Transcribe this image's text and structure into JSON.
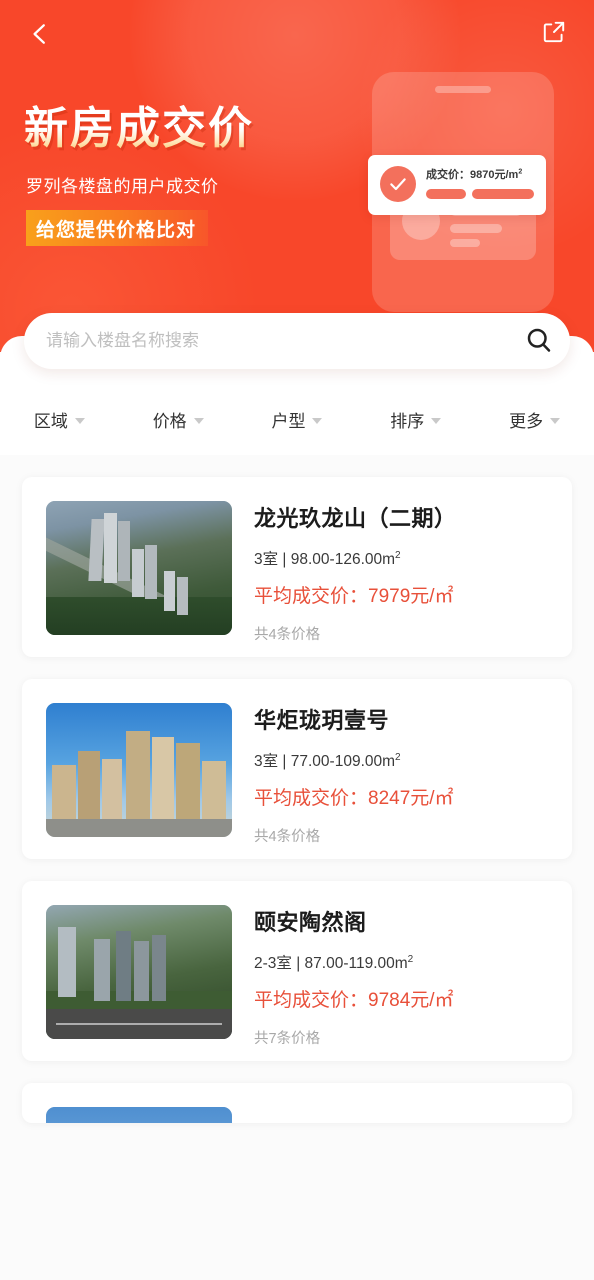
{
  "navbar": {
    "back_icon": "chevron-left-icon",
    "share_icon": "external-link-icon"
  },
  "hero": {
    "title": "新房成交价",
    "subtitle": "罗列各楼盘的用户成交价",
    "badge": "给您提供价格比对",
    "bg_color": "#F8472A",
    "badge_gradient_start": "#F9A01B",
    "badge_gradient_end": "#F8562A",
    "illustration": {
      "price_label": "成交价：9870元/m",
      "price_sup": "2",
      "check_icon": "check-circle-icon"
    }
  },
  "search": {
    "placeholder": "请输入楼盘名称搜索",
    "value": "",
    "icon": "search-icon"
  },
  "filters": [
    {
      "label": "区域",
      "caret": "chevron-down-icon"
    },
    {
      "label": "价格",
      "caret": "chevron-down-icon"
    },
    {
      "label": "户型",
      "caret": "chevron-down-icon"
    },
    {
      "label": "排序",
      "caret": "chevron-down-icon"
    },
    {
      "label": "更多",
      "caret": "chevron-down-icon"
    }
  ],
  "price_color": "#E8503A",
  "listings": [
    {
      "name": "龙光玖龙山（二期）",
      "spec": "3室 | 98.00-126.00m",
      "spec_sup": "2",
      "price": "平均成交价：7979元/㎡",
      "count": "共4条价格"
    },
    {
      "name": "华炬珑玥壹号",
      "spec": "3室 | 77.00-109.00m",
      "spec_sup": "2",
      "price": "平均成交价：8247元/㎡",
      "count": "共4条价格"
    },
    {
      "name": "颐安陶然阁",
      "spec": "2-3室 | 87.00-119.00m",
      "spec_sup": "2",
      "price": "平均成交价：9784元/㎡",
      "count": "共7条价格"
    },
    {
      "name": "",
      "spec": "",
      "spec_sup": "",
      "price": "",
      "count": ""
    }
  ]
}
